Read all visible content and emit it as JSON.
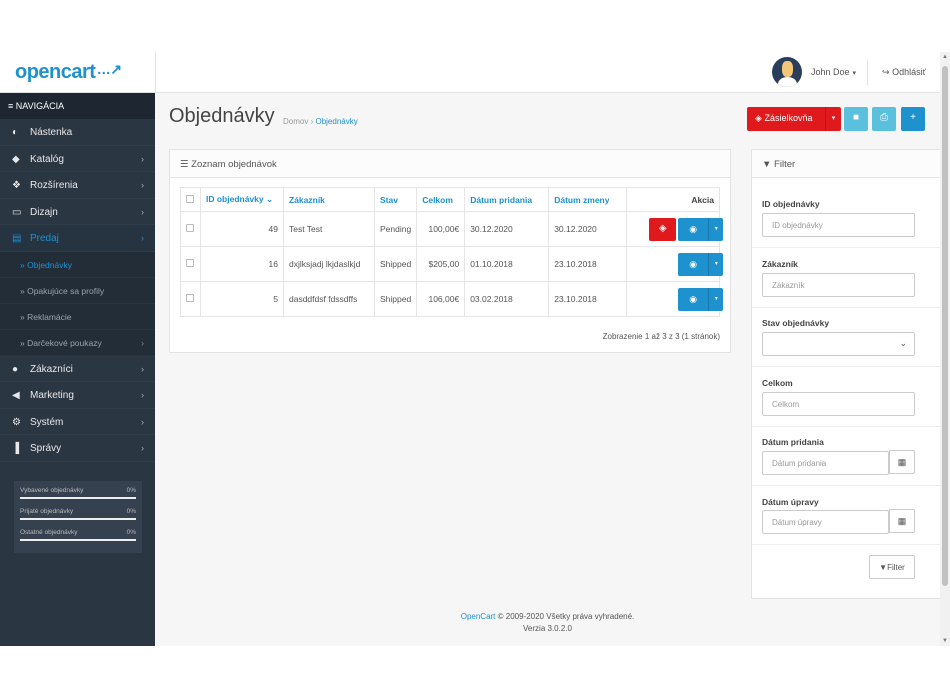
{
  "header": {
    "logo": "opencart",
    "logo_cart": "…↗",
    "username": "John Doe",
    "caret": "▾",
    "logout_icon": "↪",
    "logout_label": "Odhlásiť"
  },
  "sidebar": {
    "nav_title_icon": "≡",
    "nav_title": "NAVIGÁCIA",
    "items": [
      {
        "label": "Nástenka",
        "icon": "◐",
        "chev": ""
      },
      {
        "label": "Katalóg",
        "icon": "◆",
        "chev": "›"
      },
      {
        "label": "Rozšírenia",
        "icon": "❖",
        "chev": "›"
      },
      {
        "label": "Dizajn",
        "icon": "▭",
        "chev": "›"
      },
      {
        "label": "Predaj",
        "icon": "▤",
        "chev": "›"
      }
    ],
    "subitems": [
      {
        "label": "» Objednávky"
      },
      {
        "label": "» Opakujúce sa profily"
      },
      {
        "label": "» Reklamácie"
      },
      {
        "label": "» Darčekové poukazy",
        "chev": "›"
      }
    ],
    "items2": [
      {
        "label": "Zákazníci",
        "icon": "●",
        "chev": "›"
      },
      {
        "label": "Marketing",
        "icon": "◀",
        "chev": "›"
      },
      {
        "label": "Systém",
        "icon": "⚙",
        "chev": "›"
      },
      {
        "label": "Správy",
        "icon": "▐",
        "chev": "›"
      }
    ],
    "stats": [
      {
        "label": "Vybavené objednávky",
        "pct": "0%"
      },
      {
        "label": "Prijaté objednávky",
        "pct": "0%"
      },
      {
        "label": "Ostatné objednávky",
        "pct": "0%"
      }
    ]
  },
  "page": {
    "title": "Objednávky",
    "breadcrumb_home": "Domov",
    "breadcrumb_sep": "›",
    "breadcrumb_current": "Objednávky",
    "zasielkovna_label": "Zásielkovňa",
    "zasielkovna_icon": "◈",
    "zasielkovna_dd": "▾",
    "btn_ship_icon": "■",
    "btn_print_icon": "⎙",
    "btn_add_icon": "+"
  },
  "orders": {
    "panel_icon": "☰",
    "panel_title": "Zoznam objednávok",
    "columns": [
      "ID objednávky",
      "Zákazník",
      "Stav",
      "Celkom",
      "Dátum pridania",
      "Dátum zmeny",
      "Akcia"
    ],
    "sort_caret": "⌄",
    "rows": [
      {
        "id": "49",
        "customer": "Test Test",
        "status": "Pending",
        "total": "100,00€",
        "date_added": "30.12.2020",
        "date_modified": "30.12.2020",
        "zas": true
      },
      {
        "id": "16",
        "customer": "dxjlksjadj lkjdaslkjd",
        "status": "Shipped",
        "total": "$205,00",
        "date_added": "01.10.2018",
        "date_modified": "23.10.2018",
        "zas": false
      },
      {
        "id": "5",
        "customer": "dasddfdsf fdssdffs",
        "status": "Shipped",
        "total": "106,00€",
        "date_added": "03.02.2018",
        "date_modified": "23.10.2018",
        "zas": false
      }
    ],
    "view_icon": "◉",
    "dd_icon": "▾",
    "zas_icon": "◈",
    "pager": "Zobrazenie 1 až 3 z 3 (1 stránok)"
  },
  "filter": {
    "icon": "▼",
    "title": "Filter",
    "order_id_label": "ID objednávky",
    "order_id_placeholder": "ID objednávky",
    "customer_label": "Zákazník",
    "customer_placeholder": "Zákazník",
    "status_label": "Stav objednávky",
    "select_caret": "⌄",
    "total_label": "Celkom",
    "total_placeholder": "Celkom",
    "date_added_label": "Dátum pridania",
    "date_added_placeholder": "Dátum pridania",
    "date_modified_label": "Dátum úpravy",
    "date_modified_placeholder": "Dátum úpravy",
    "calendar_icon": "▦",
    "button_label": "Filter",
    "button_icon": "▼"
  },
  "footer": {
    "link": "OpenCart",
    "text": " © 2009-2020 Všetky práva vyhradené.",
    "version": "Verzia 3.0.2.0"
  },
  "colors": {
    "primary": "#1e91cf",
    "danger": "#e0191c",
    "info": "#5bc0de",
    "sidebar": "#2b3643"
  }
}
